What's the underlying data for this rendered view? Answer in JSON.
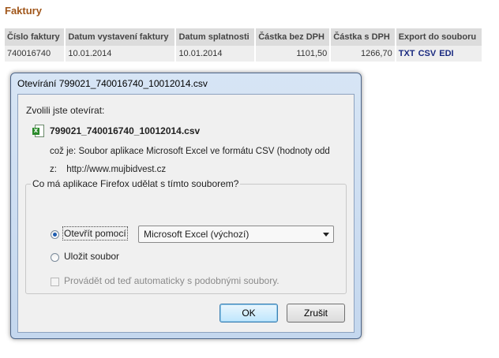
{
  "page": {
    "section_title": "Faktury"
  },
  "invoices": {
    "columns": [
      "Číslo faktury",
      "Datum vystavení faktury",
      "Datum splatnosti",
      "Částka bez DPH",
      "Částka s DPH",
      "Export do souboru"
    ],
    "rows": [
      {
        "number": "740016740",
        "issued": "10.01.2014",
        "due": "10.01.2014",
        "amount_net": "1101,50",
        "amount_gross": "1266,70",
        "exports": [
          "TXT",
          "CSV",
          "EDI"
        ]
      }
    ]
  },
  "dialog": {
    "title": "Otevírání 799021_740016740_10012014.csv",
    "opening_label": "Zvolili jste otevírat:",
    "file_name": "799021_740016740_10012014.csv",
    "file_icon": "excel-csv-icon",
    "type_key": "což je:",
    "type_value": "Soubor aplikace Microsoft Excel ve formátu CSV (hodnoty odd",
    "from_key": "z:",
    "from_value": "http://www.mujbidvest.cz",
    "question": "Co má aplikace Firefox udělat s tímto souborem?",
    "open_with_label": "Otevřít pomocí",
    "open_with_selected": true,
    "app_select_value": "Microsoft Excel (výchozí)",
    "save_label": "Uložit soubor",
    "auto_label": "Provádět od teď automaticky s podobnými soubory.",
    "auto_checked": false,
    "ok_label": "OK",
    "cancel_label": "Zrušit"
  },
  "colors": {
    "section_title": "#a0561a",
    "export_link": "#1a2a80",
    "dialog_frame": "#c4d7ee"
  }
}
